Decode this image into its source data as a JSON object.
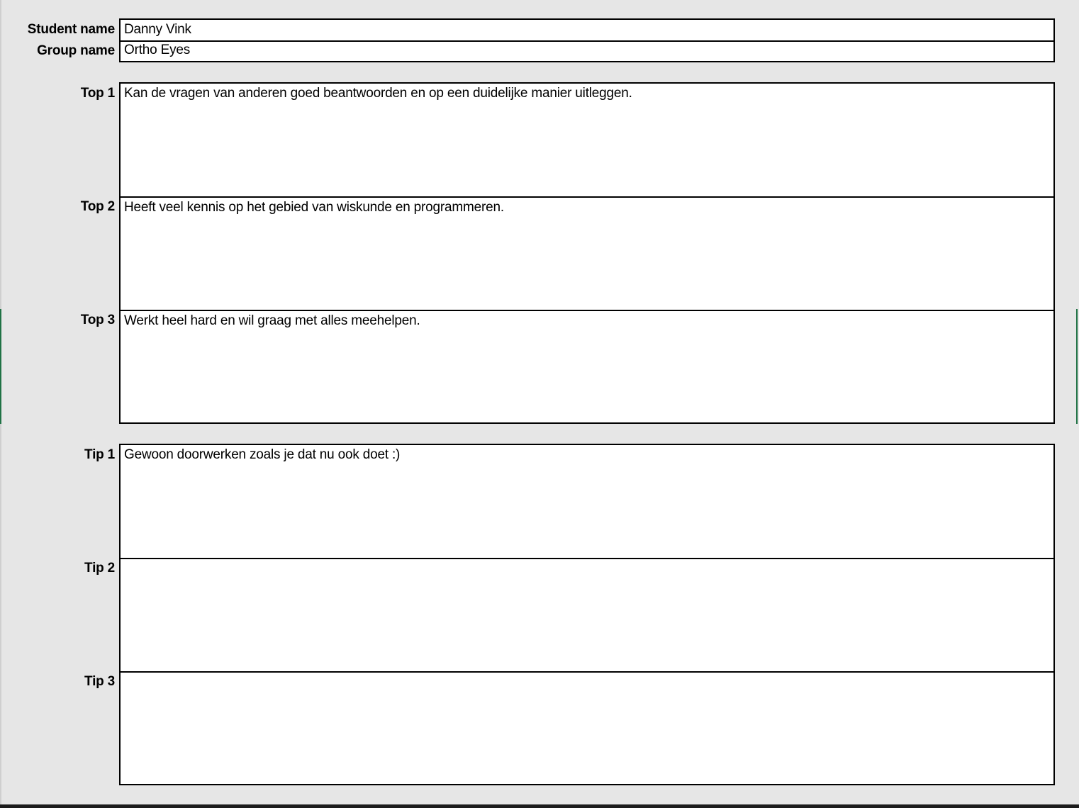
{
  "info": {
    "student_label": "Student name",
    "student_value": "Danny Vink",
    "group_label": "Group name",
    "group_value": "Ortho Eyes"
  },
  "tops": [
    {
      "label": "Top 1",
      "text": "Kan de vragen van anderen goed beantwoorden en op een duidelijke manier uitleggen."
    },
    {
      "label": "Top 2",
      "text": "Heeft veel kennis op het gebied van wiskunde en programmeren."
    },
    {
      "label": "Top 3",
      "text": "Werkt heel hard en wil graag met alles meehelpen."
    }
  ],
  "tips": [
    {
      "label": "Tip 1",
      "text": "Gewoon doorwerken zoals je dat nu ook doet :)"
    },
    {
      "label": "Tip 2",
      "text": ""
    },
    {
      "label": "Tip 3",
      "text": ""
    }
  ],
  "colors": {
    "sheet_background": "#e6e6e6",
    "cell_background": "#ffffff",
    "border": "#000000",
    "accent_green": "#217346"
  }
}
